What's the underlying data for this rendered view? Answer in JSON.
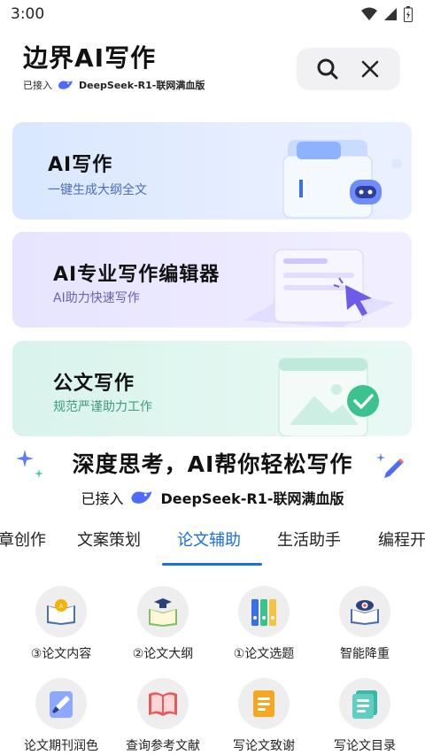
{
  "status": {
    "time": "3:00"
  },
  "header": {
    "title": "边界AI写作",
    "connected_label": "已接入",
    "model_name": "DeepSeek-R1-联网满血版"
  },
  "cards": [
    {
      "title": "AI写作",
      "desc": "一键生成大纲全文"
    },
    {
      "title": "AI专业写作编辑器",
      "desc": "AI助力快速写作"
    },
    {
      "title": "公文写作",
      "desc": "规范严谨助力工作"
    }
  ],
  "banner": {
    "title": "深度思考，AI帮你轻松写作",
    "connected_label": "已接入",
    "model_name": "DeepSeek-R1-联网满血版"
  },
  "tabs": [
    "章创作",
    "文案策划",
    "论文辅助",
    "生活助手",
    "编程开"
  ],
  "active_tab": "论文辅助",
  "tools": [
    {
      "label": "③论文内容",
      "icon": "book-lamp-icon"
    },
    {
      "label": "②论文大纲",
      "icon": "graduation-book-icon"
    },
    {
      "label": "①论文选题",
      "icon": "binders-icon"
    },
    {
      "label": "智能降重",
      "icon": "eye-book-icon"
    },
    {
      "label": "论文期刊润色",
      "icon": "paint-brush-icon"
    },
    {
      "label": "查询参考文献",
      "icon": "open-book-icon"
    },
    {
      "label": "写论文致谢",
      "icon": "document-icon"
    },
    {
      "label": "写论文目录",
      "icon": "list-document-icon"
    }
  ],
  "colors": {
    "accent": "#1a6fe0",
    "deepseek_blue": "#4d6bfe"
  }
}
